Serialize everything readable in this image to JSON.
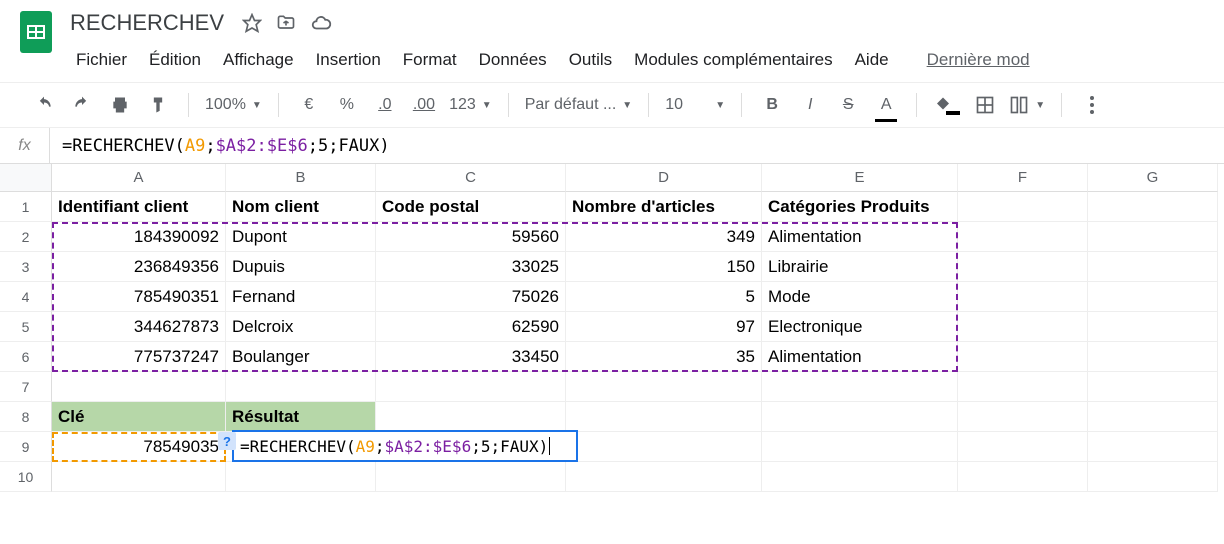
{
  "doc_title": "RECHERCHEV",
  "menus": {
    "file": "Fichier",
    "edit": "Édition",
    "view": "Affichage",
    "insert": "Insertion",
    "format": "Format",
    "data": "Données",
    "tools": "Outils",
    "addons": "Modules complémentaires",
    "help": "Aide",
    "lastmod": "Dernière mod"
  },
  "toolbar": {
    "zoom": "100%",
    "currency": "€",
    "percent": "%",
    "dec_less": ".0",
    "dec_more": ".00",
    "num_fmt": "123",
    "font": "Par défaut ...",
    "font_size": "10",
    "bold": "B",
    "italic": "I",
    "strike": "S",
    "text_color": "A"
  },
  "formula_bar": {
    "prefix": "=RECHERCHEV(",
    "arg1": "A9",
    "sep1": ";",
    "arg2": "$A$2:$E$6",
    "sep2": ";",
    "arg3": "5",
    "sep3": ";",
    "arg4": "FAUX",
    "suffix": ")"
  },
  "columns": [
    "A",
    "B",
    "C",
    "D",
    "E",
    "F",
    "G"
  ],
  "rows": [
    "1",
    "2",
    "3",
    "4",
    "5",
    "6",
    "7",
    "8",
    "9",
    "10"
  ],
  "chart_data": {
    "type": "table",
    "headers": [
      "Identifiant client",
      "Nom client",
      "Code postal",
      "Nombre d'articles",
      "Catégories Produits"
    ],
    "rows": [
      {
        "id": "184390092",
        "nom": "Dupont",
        "cp": "59560",
        "nb": "349",
        "cat": "Alimentation"
      },
      {
        "id": "236849356",
        "nom": "Dupuis",
        "cp": "33025",
        "nb": "150",
        "cat": "Librairie"
      },
      {
        "id": "785490351",
        "nom": "Fernand",
        "cp": "75026",
        "nb": "5",
        "cat": "Mode"
      },
      {
        "id": "344627873",
        "nom": "Delcroix",
        "cp": "62590",
        "nb": "97",
        "cat": "Electronique"
      },
      {
        "id": "775737247",
        "nom": "Boulanger",
        "cp": "33450",
        "nb": "35",
        "cat": "Alimentation"
      }
    ],
    "lookup": {
      "key_label": "Clé",
      "result_label": "Résultat",
      "key_value": "78549035"
    }
  },
  "formula_cell": {
    "help": "?",
    "prefix": "=RECHERCHEV(",
    "arg1": "A9",
    "sep1": ";",
    "arg2": "$A$2:$E$6",
    "sep2": ";",
    "arg3": "5",
    "sep3": ";",
    "arg4": "FAUX",
    "suffix": ")"
  },
  "fx_label": "fx"
}
